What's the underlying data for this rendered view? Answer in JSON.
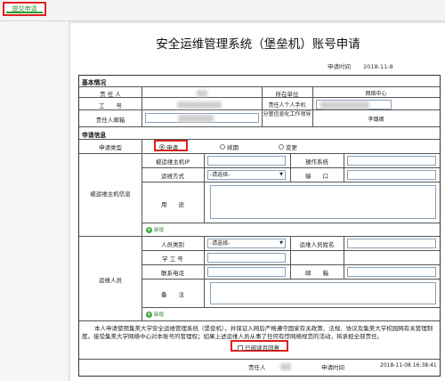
{
  "toolbar": {
    "submit_label": "提交申请"
  },
  "doc": {
    "title": "安全运维管理系统（堡垒机）账号申请",
    "apply_time_label": "申请时间",
    "apply_time_value": "2018-11-8"
  },
  "basic": {
    "section_label": "基本情况",
    "person_label": "责 任 人",
    "unit_label": "所在单位",
    "unit_value": "网络中心",
    "staff_no_label": "工　　号",
    "phone_label": "责任人个人手机",
    "email_label": "责任人邮箱",
    "leader_label": "分管信息化工作领导",
    "leader_value": "李璐嫣"
  },
  "apply": {
    "section_label": "申请信息",
    "type_label": "申请类型",
    "options": [
      "申请",
      "续期",
      "变更"
    ]
  },
  "host": {
    "group_label": "被运维主机信息",
    "ip_label": "被运维主机IP",
    "os_label": "操作系统",
    "method_label": "运维方式",
    "method_value": "-请选择-",
    "port_label": "端　　口",
    "use_label": "用　　途",
    "add_label": "新增"
  },
  "ops": {
    "group_label": "运维人员",
    "category_label": "人员类别",
    "category_value": "-请选择-",
    "name_label": "运维人员姓名",
    "student_no_label": "学 工 号",
    "contact_label": "联系电话",
    "email_label": "邮　　箱",
    "remark_label": "备　　注",
    "add_label": "新增"
  },
  "footer": {
    "notice": "本人申请使用集美大学安全运维管理系统（堡垒机），并保证入网后严格遵守国家有关政策、法规、协议及集美大学校园网有关管理制度。接受集美大学网络中心对本账号的管理权；如果上述运维人员从事了任何有悖网络规范的活动，将承担全部责任。",
    "agree_label": "已阅读且同意",
    "person_label": "责任人",
    "time_label": "申请时间",
    "time_value": "2018-11-08 16:38:41"
  }
}
